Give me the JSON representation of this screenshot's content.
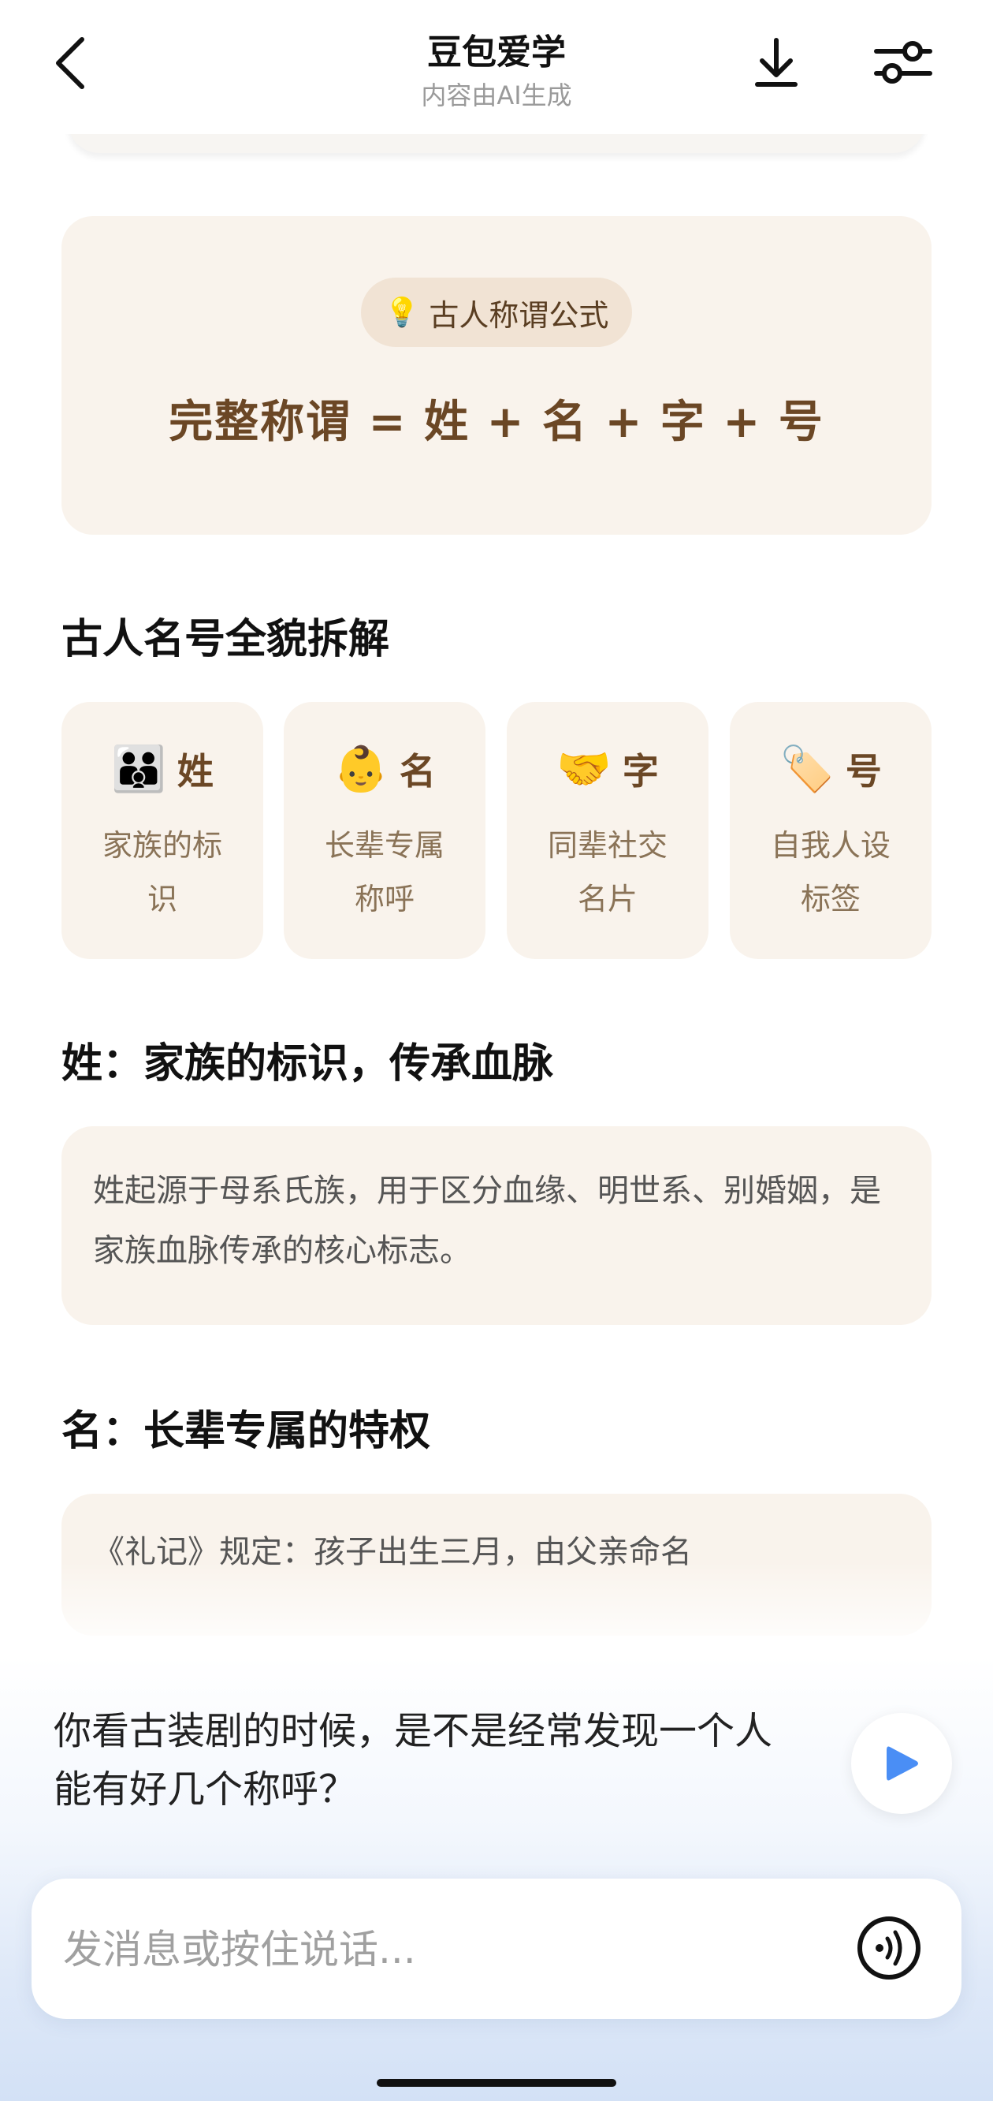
{
  "header": {
    "title": "豆包爱学",
    "subtitle": "内容由AI生成"
  },
  "formula": {
    "pill_icon": "lightbulb-icon",
    "pill_label": "古人称谓公式",
    "text": "完整称谓 = 姓 + 名 + 字 + 号"
  },
  "sections": {
    "overview_heading": "古人名号全貌拆解",
    "surname_heading": "姓：家族的标识，传承血脉",
    "surname_text": "姓起源于母系氏族，用于区分血缘、明世系、别婚姻，是家族血脉传承的核心标志。",
    "name_heading": "名：长辈专属的特权",
    "name_text": "《礼记》规定：孩子出生三月，由父亲命名"
  },
  "components": [
    {
      "emoji": "👪",
      "icon": "family-icon",
      "char": "姓",
      "desc": "家族的标识"
    },
    {
      "emoji": "👶",
      "icon": "baby-icon",
      "char": "名",
      "desc": "长辈专属称呼"
    },
    {
      "emoji": "🤝",
      "icon": "handshake-icon",
      "char": "字",
      "desc": "同辈社交名片"
    },
    {
      "emoji": "🏷️",
      "icon": "tag-icon",
      "char": "号",
      "desc": "自我人设标签"
    }
  ],
  "prompt": {
    "text": "你看古装剧的时候，是不是经常发现一个人能有好几个称呼？"
  },
  "input": {
    "placeholder": "发消息或按住说话...",
    "value": ""
  },
  "colors": {
    "card_bg": "#f9f3ec",
    "accent_brown": "#6b4725",
    "muted_brown": "#8a7357",
    "play_blue": "#4a8ef5"
  }
}
